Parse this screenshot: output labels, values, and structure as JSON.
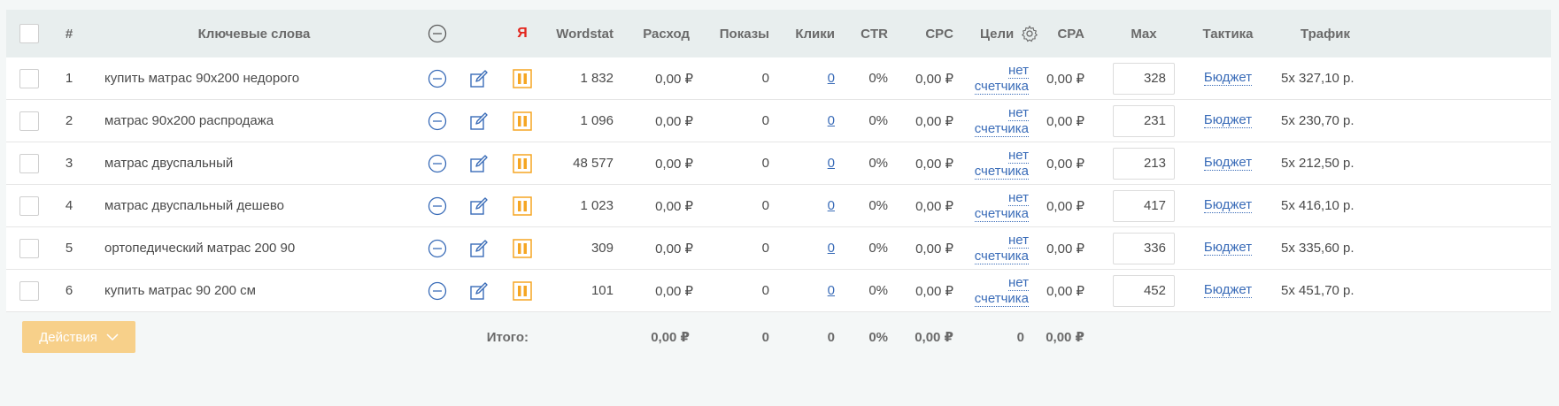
{
  "header": {
    "num": "#",
    "keywords": "Ключевые слова",
    "ya": "Я",
    "wordstat": "Wordstat",
    "spend": "Расход",
    "impressions": "Показы",
    "clicks": "Клики",
    "ctr": "CTR",
    "cpc": "CPC",
    "goals": "Цели",
    "cpa": "CPA",
    "max": "Max",
    "tactic": "Тактика",
    "traffic": "Трафик"
  },
  "rows": [
    {
      "n": "1",
      "keyword": "купить матрас 90х200 недорого",
      "wordstat": "1 832",
      "spend": "0,00 ₽",
      "impressions": "0",
      "clicks": "0",
      "ctr": "0%",
      "cpc": "0,00 ₽",
      "goal1": "нет",
      "goal2": "счетчика",
      "cpa": "0,00 ₽",
      "max": "328",
      "tactic": "Бюджет",
      "traffic": "5х 327,10 р."
    },
    {
      "n": "2",
      "keyword": "матрас 90х200 распродажа",
      "wordstat": "1 096",
      "spend": "0,00 ₽",
      "impressions": "0",
      "clicks": "0",
      "ctr": "0%",
      "cpc": "0,00 ₽",
      "goal1": "нет",
      "goal2": "счетчика",
      "cpa": "0,00 ₽",
      "max": "231",
      "tactic": "Бюджет",
      "traffic": "5х 230,70 р."
    },
    {
      "n": "3",
      "keyword": "матрас двуспальный",
      "wordstat": "48 577",
      "spend": "0,00 ₽",
      "impressions": "0",
      "clicks": "0",
      "ctr": "0%",
      "cpc": "0,00 ₽",
      "goal1": "нет",
      "goal2": "счетчика",
      "cpa": "0,00 ₽",
      "max": "213",
      "tactic": "Бюджет",
      "traffic": "5х 212,50 р."
    },
    {
      "n": "4",
      "keyword": "матрас двуспальный дешево",
      "wordstat": "1 023",
      "spend": "0,00 ₽",
      "impressions": "0",
      "clicks": "0",
      "ctr": "0%",
      "cpc": "0,00 ₽",
      "goal1": "нет",
      "goal2": "счетчика",
      "cpa": "0,00 ₽",
      "max": "417",
      "tactic": "Бюджет",
      "traffic": "5х 416,10 р."
    },
    {
      "n": "5",
      "keyword": "ортопедический матрас 200 90",
      "wordstat": "309",
      "spend": "0,00 ₽",
      "impressions": "0",
      "clicks": "0",
      "ctr": "0%",
      "cpc": "0,00 ₽",
      "goal1": "нет",
      "goal2": "счетчика",
      "cpa": "0,00 ₽",
      "max": "336",
      "tactic": "Бюджет",
      "traffic": "5х 335,60 р."
    },
    {
      "n": "6",
      "keyword": "купить матрас 90 200 см",
      "wordstat": "101",
      "spend": "0,00 ₽",
      "impressions": "0",
      "clicks": "0",
      "ctr": "0%",
      "cpc": "0,00 ₽",
      "goal1": "нет",
      "goal2": "счетчика",
      "cpa": "0,00 ₽",
      "max": "452",
      "tactic": "Бюджет",
      "traffic": "5х 451,70 р."
    }
  ],
  "footer": {
    "actions_label": "Действия",
    "total_label": "Итого:",
    "spend": "0,00 ₽",
    "impressions": "0",
    "clicks": "0",
    "ctr": "0%",
    "cpc": "0,00 ₽",
    "goals": "0",
    "cpa": "0,00 ₽"
  },
  "icons": {
    "minus": "minus-circle-icon",
    "edit": "edit-icon",
    "pause": "pause-icon",
    "gear": "gear-icon",
    "chevron": "chevron-down-icon"
  },
  "colors": {
    "accent_orange": "#f5a623",
    "link_blue": "#3a6cb8",
    "yandex_red": "#e3241b",
    "actions_button": "#f7d08a"
  }
}
